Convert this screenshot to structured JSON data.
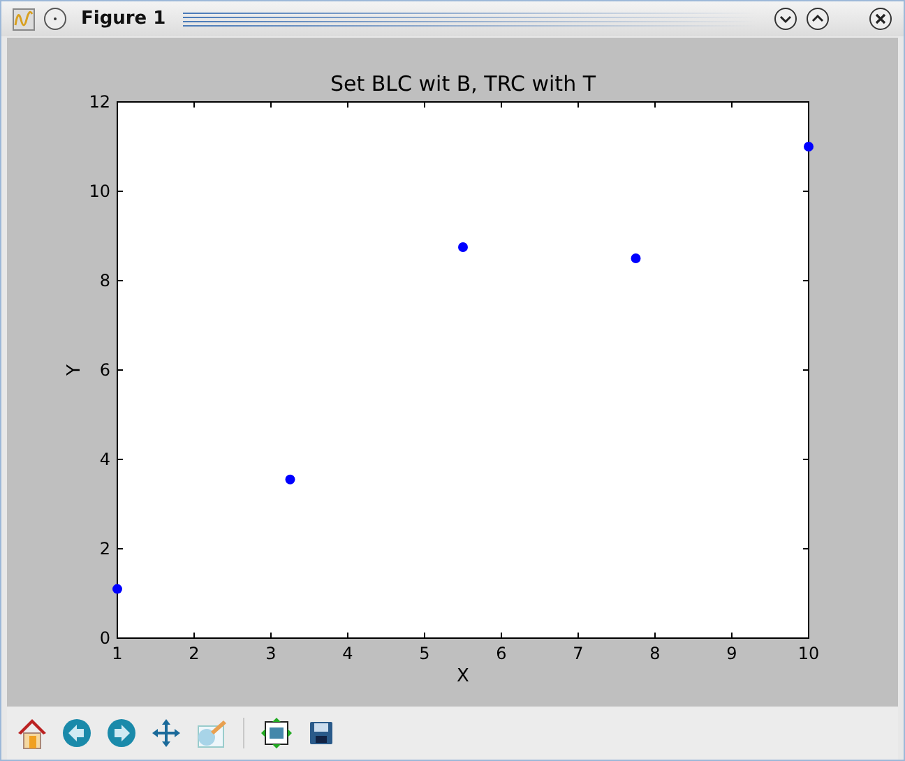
{
  "window": {
    "title": "Figure 1"
  },
  "figure": {
    "chart_data": {
      "type": "scatter",
      "title": "Set BLC wit B, TRC with T",
      "xlabel": "X",
      "ylabel": "Y",
      "xlim": [
        1,
        10
      ],
      "ylim": [
        0,
        12
      ],
      "xticks": [
        {
          "value": 1,
          "label": "1"
        },
        {
          "value": 2,
          "label": "2"
        },
        {
          "value": 3,
          "label": "3"
        },
        {
          "value": 4,
          "label": "4"
        },
        {
          "value": 5,
          "label": "5"
        },
        {
          "value": 6,
          "label": "6"
        },
        {
          "value": 7,
          "label": "7"
        },
        {
          "value": 8,
          "label": "8"
        },
        {
          "value": 9,
          "label": "9"
        },
        {
          "value": 10,
          "label": "10"
        }
      ],
      "yticks": [
        {
          "value": 0,
          "label": "0"
        },
        {
          "value": 2,
          "label": "2"
        },
        {
          "value": 4,
          "label": "4"
        },
        {
          "value": 6,
          "label": "6"
        },
        {
          "value": 8,
          "label": "8"
        },
        {
          "value": 10,
          "label": "10"
        },
        {
          "value": 12,
          "label": "12"
        }
      ],
      "x": [
        1,
        3.25,
        5.5,
        7.75,
        10
      ],
      "series": [
        {
          "color": "#0000ff",
          "values": [
            1.1,
            3.55,
            8.75,
            8.5,
            11
          ]
        }
      ]
    }
  },
  "toolbar": [
    {
      "kind": "home"
    },
    {
      "kind": "back"
    },
    {
      "kind": "forward"
    },
    {
      "kind": "pan"
    },
    {
      "kind": "edit"
    },
    {
      "kind": "separator"
    },
    {
      "kind": "configure"
    },
    {
      "kind": "save"
    }
  ]
}
